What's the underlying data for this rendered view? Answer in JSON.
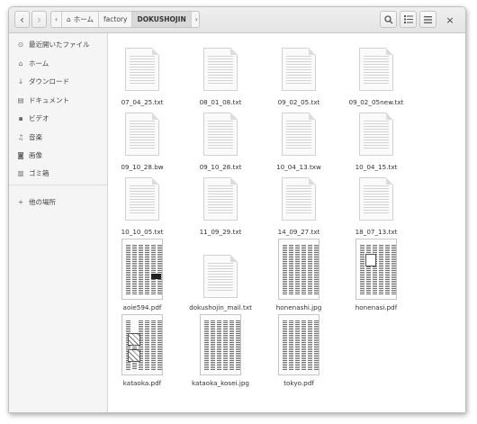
{
  "header": {
    "back_icon": "‹",
    "forward_icon": "›",
    "crumbs": [
      "ホーム",
      "factory",
      "DOKUSHOJIN"
    ],
    "menu_icons": [
      "search-icon",
      "view-list-icon",
      "hamburger-icon"
    ],
    "close_icon": "×"
  },
  "sidebar": {
    "items": [
      {
        "icon": "⊙",
        "label": "最近開いたファイル"
      },
      {
        "icon": "⌂",
        "label": "ホーム"
      },
      {
        "icon": "↓",
        "label": "ダウンロード"
      },
      {
        "icon": "▤",
        "label": "ドキュメント"
      },
      {
        "icon": "▪",
        "label": "ビデオ"
      },
      {
        "icon": "♫",
        "label": "音楽"
      },
      {
        "icon": "◙",
        "label": "画像"
      },
      {
        "icon": "▥",
        "label": "ゴミ箱"
      },
      {
        "icon": "+",
        "label": "他の場所"
      }
    ]
  },
  "files": [
    {
      "name": "07_04_25.txt",
      "kind": "text"
    },
    {
      "name": "08_01_08.txt",
      "kind": "text"
    },
    {
      "name": "09_02_05.txt",
      "kind": "text"
    },
    {
      "name": "09_02_05new.txt",
      "kind": "text"
    },
    {
      "name": "09_10_28.bw",
      "kind": "text"
    },
    {
      "name": "09_10_28.txt",
      "kind": "text"
    },
    {
      "name": "10_04_13.txw",
      "kind": "text"
    },
    {
      "name": "10_04_15.txt",
      "kind": "text"
    },
    {
      "name": "10_10_05.txt",
      "kind": "text"
    },
    {
      "name": "11_09_29.txt",
      "kind": "text"
    },
    {
      "name": "14_09_27.txt",
      "kind": "text"
    },
    {
      "name": "18_07_13.txt",
      "kind": "text"
    },
    {
      "name": "aoie594.pdf",
      "kind": "scan"
    },
    {
      "name": "dokushojin_mail.txt",
      "kind": "text"
    },
    {
      "name": "honenashi.jpg",
      "kind": "scan"
    },
    {
      "name": "honenasi.pdf",
      "kind": "scan"
    },
    {
      "name": "kataoka.pdf",
      "kind": "scan"
    },
    {
      "name": "kataoka_kosei.jpg",
      "kind": "scan"
    },
    {
      "name": "tokyo.pdf",
      "kind": "scan"
    }
  ]
}
